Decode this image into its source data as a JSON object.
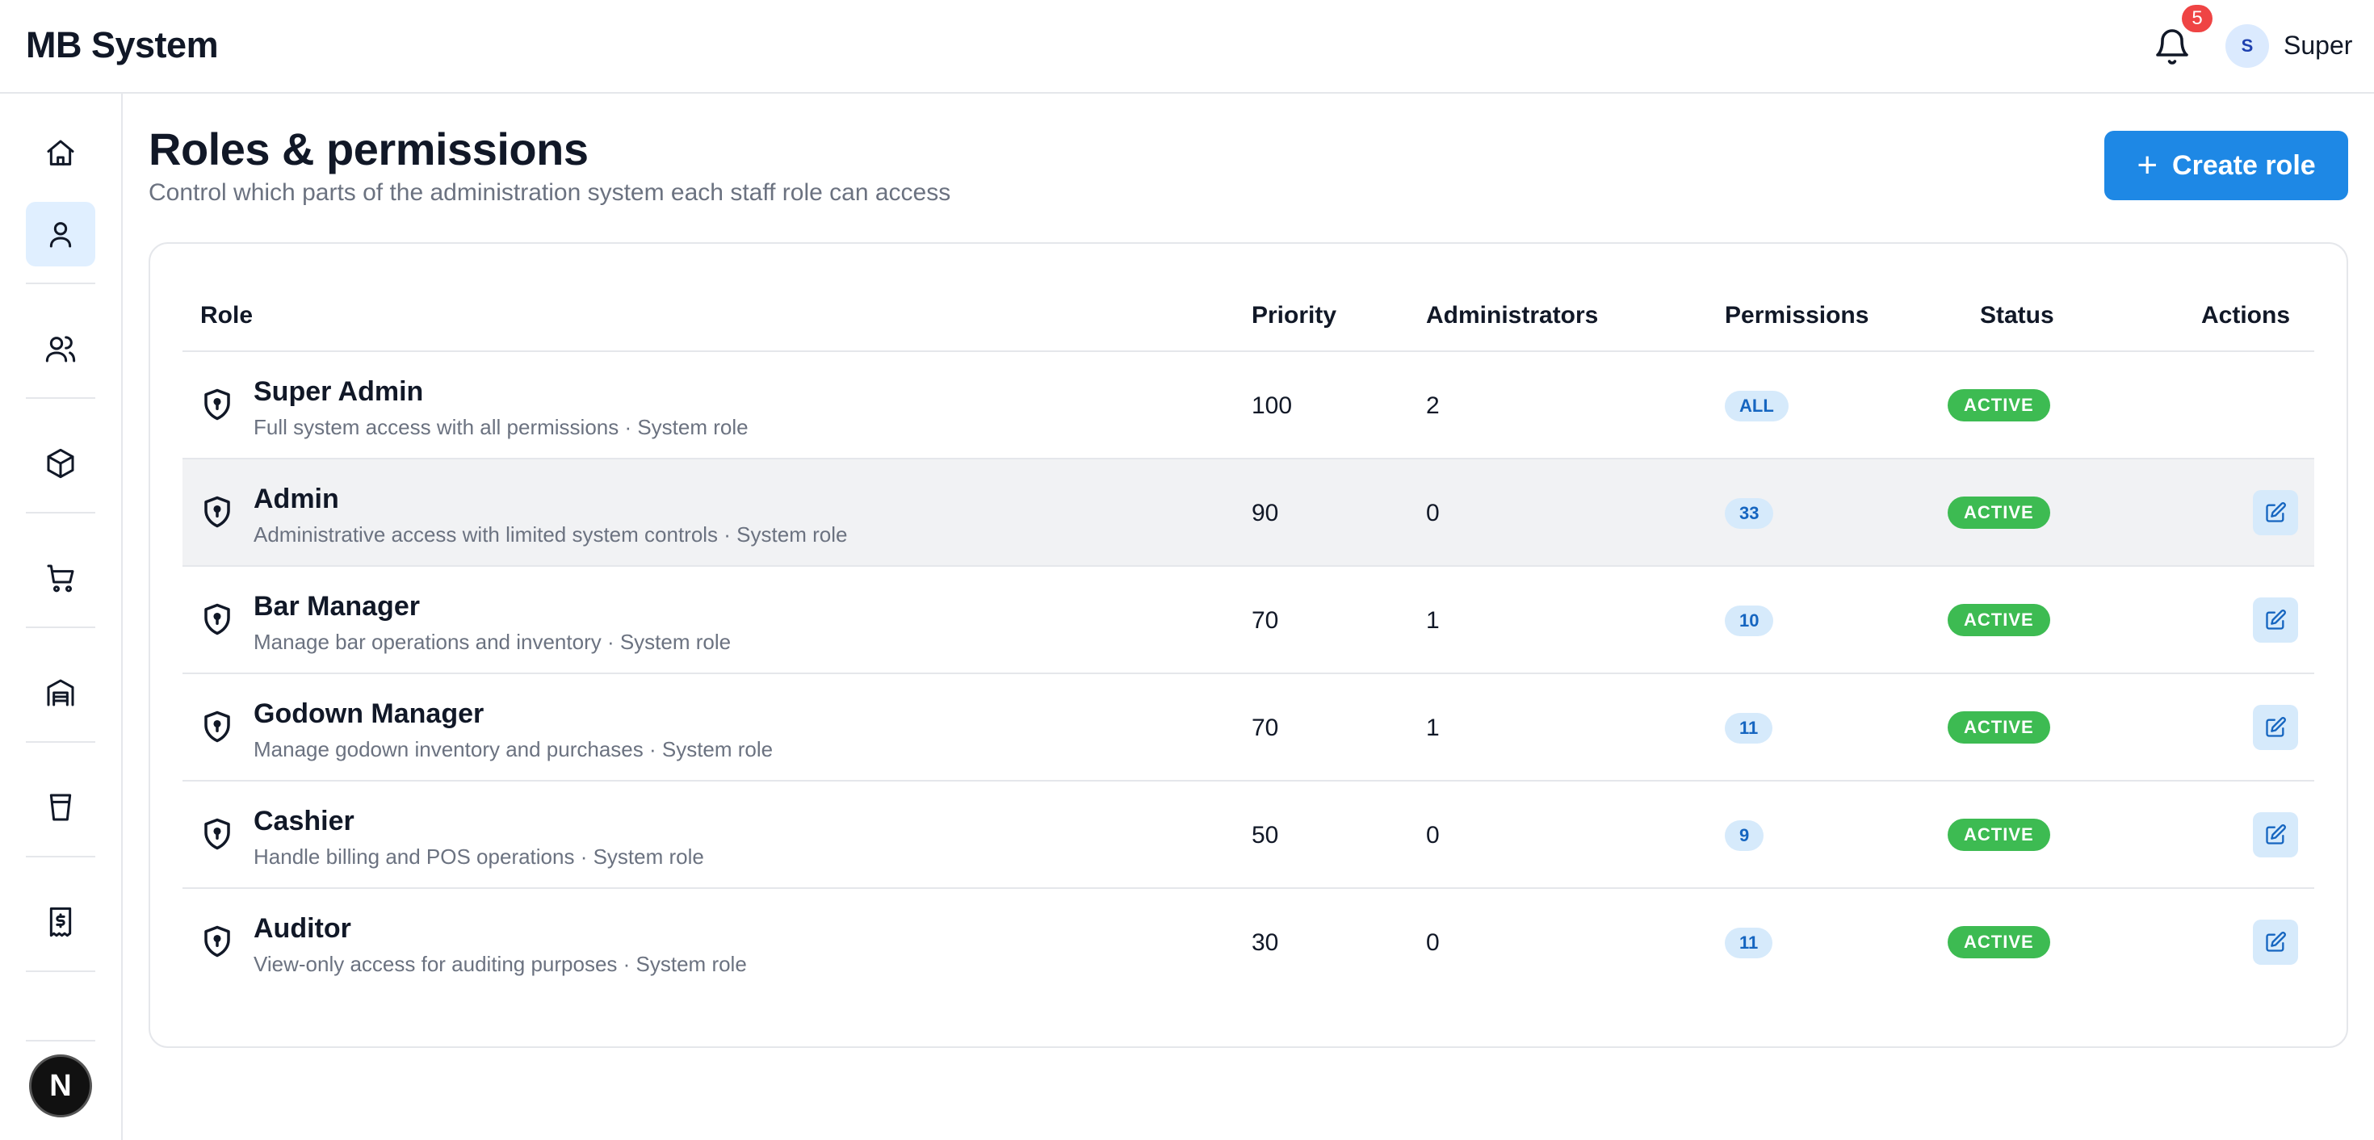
{
  "app": {
    "title": "MB System"
  },
  "header": {
    "notification_count": "5",
    "user_initial": "S",
    "user_name": "Super"
  },
  "sidebar": {
    "items": [
      {
        "icon": "home-icon",
        "active": false
      },
      {
        "icon": "user-icon",
        "active": true
      },
      {
        "icon": "users-icon",
        "active": false
      },
      {
        "icon": "box-icon",
        "active": false
      },
      {
        "icon": "cart-icon",
        "active": false
      },
      {
        "icon": "warehouse-icon",
        "active": false
      },
      {
        "icon": "cup-icon",
        "active": false
      },
      {
        "icon": "receipt-icon",
        "active": false
      }
    ],
    "footer_logo": "N"
  },
  "page": {
    "title": "Roles & permissions",
    "subtitle": "Control which parts of the administration system each staff role can access",
    "create_button": "Create role"
  },
  "table": {
    "columns": {
      "role": "Role",
      "priority": "Priority",
      "administrators": "Administrators",
      "permissions": "Permissions",
      "status": "Status",
      "actions": "Actions"
    },
    "rows": [
      {
        "name": "Super Admin",
        "description": "Full system access with all permissions · System role",
        "priority": "100",
        "administrators": "2",
        "permissions": "ALL",
        "status": "ACTIVE",
        "editable": false
      },
      {
        "name": "Admin",
        "description": "Administrative access with limited system controls · System role",
        "priority": "90",
        "administrators": "0",
        "permissions": "33",
        "status": "ACTIVE",
        "editable": true
      },
      {
        "name": "Bar Manager",
        "description": "Manage bar operations and inventory · System role",
        "priority": "70",
        "administrators": "1",
        "permissions": "10",
        "status": "ACTIVE",
        "editable": true
      },
      {
        "name": "Godown Manager",
        "description": "Manage godown inventory and purchases · System role",
        "priority": "70",
        "administrators": "1",
        "permissions": "11",
        "status": "ACTIVE",
        "editable": true
      },
      {
        "name": "Cashier",
        "description": "Handle billing and POS operations · System role",
        "priority": "50",
        "administrators": "0",
        "permissions": "9",
        "status": "ACTIVE",
        "editable": true
      },
      {
        "name": "Auditor",
        "description": "View-only access for auditing purposes · System role",
        "priority": "30",
        "administrators": "0",
        "permissions": "11",
        "status": "ACTIVE",
        "editable": true
      }
    ]
  },
  "colors": {
    "accent": "#1e88e5",
    "active_status": "#3dbb52",
    "notification": "#ef4444"
  }
}
